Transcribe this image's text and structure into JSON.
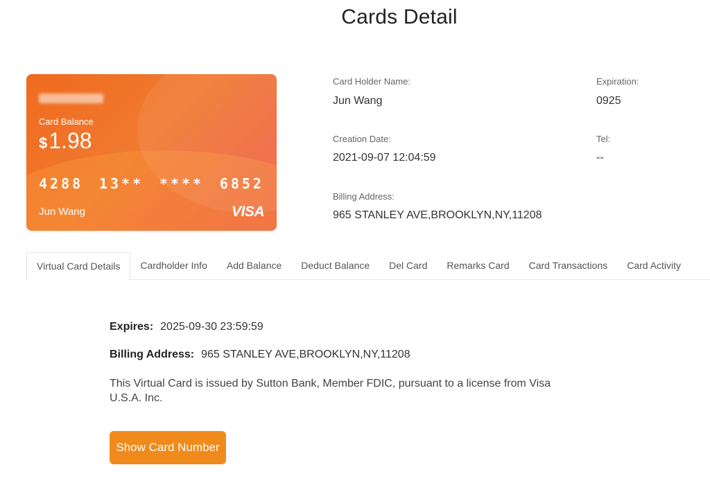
{
  "page": {
    "title": "Cards Detail"
  },
  "card": {
    "balance_label": "Card Balance",
    "currency_symbol": "$",
    "balance": "1.98",
    "number_groups": [
      "4288",
      "13**",
      "****",
      "6852"
    ],
    "holder_name": "Jun Wang",
    "brand": "VISA",
    "colors": {
      "start": "#f06a1e",
      "end": "#ee6248"
    }
  },
  "info": {
    "holder_label": "Card Holder Name:",
    "holder_value": "Jun Wang",
    "expiration_label": "Expiration:",
    "expiration_value": "0925",
    "creation_label": "Creation Date:",
    "creation_value": "2021-09-07 12:04:59",
    "tel_label": "Tel:",
    "tel_value": "--",
    "billing_label": "Billing Address:",
    "billing_value": "965 STANLEY AVE,BROOKLYN,NY,11208"
  },
  "tabs": [
    {
      "label": "Virtual Card Details",
      "active": true
    },
    {
      "label": "Cardholder Info"
    },
    {
      "label": "Add Balance"
    },
    {
      "label": "Deduct Balance"
    },
    {
      "label": "Del Card"
    },
    {
      "label": "Remarks Card"
    },
    {
      "label": "Card Transactions"
    },
    {
      "label": "Card Activity"
    }
  ],
  "details": {
    "expires_label": "Expires:",
    "expires_value": "2025-09-30 23:59:59",
    "billing_label": "Billing Address:",
    "billing_value": "965 STANLEY AVE,BROOKLYN,NY,11208",
    "disclaimer": "This Virtual Card is issued by Sutton Bank, Member FDIC, pursuant to a license from Visa U.S.A. Inc.",
    "show_button": "Show Card Number"
  },
  "colors": {
    "accent": "#f08a1c"
  }
}
